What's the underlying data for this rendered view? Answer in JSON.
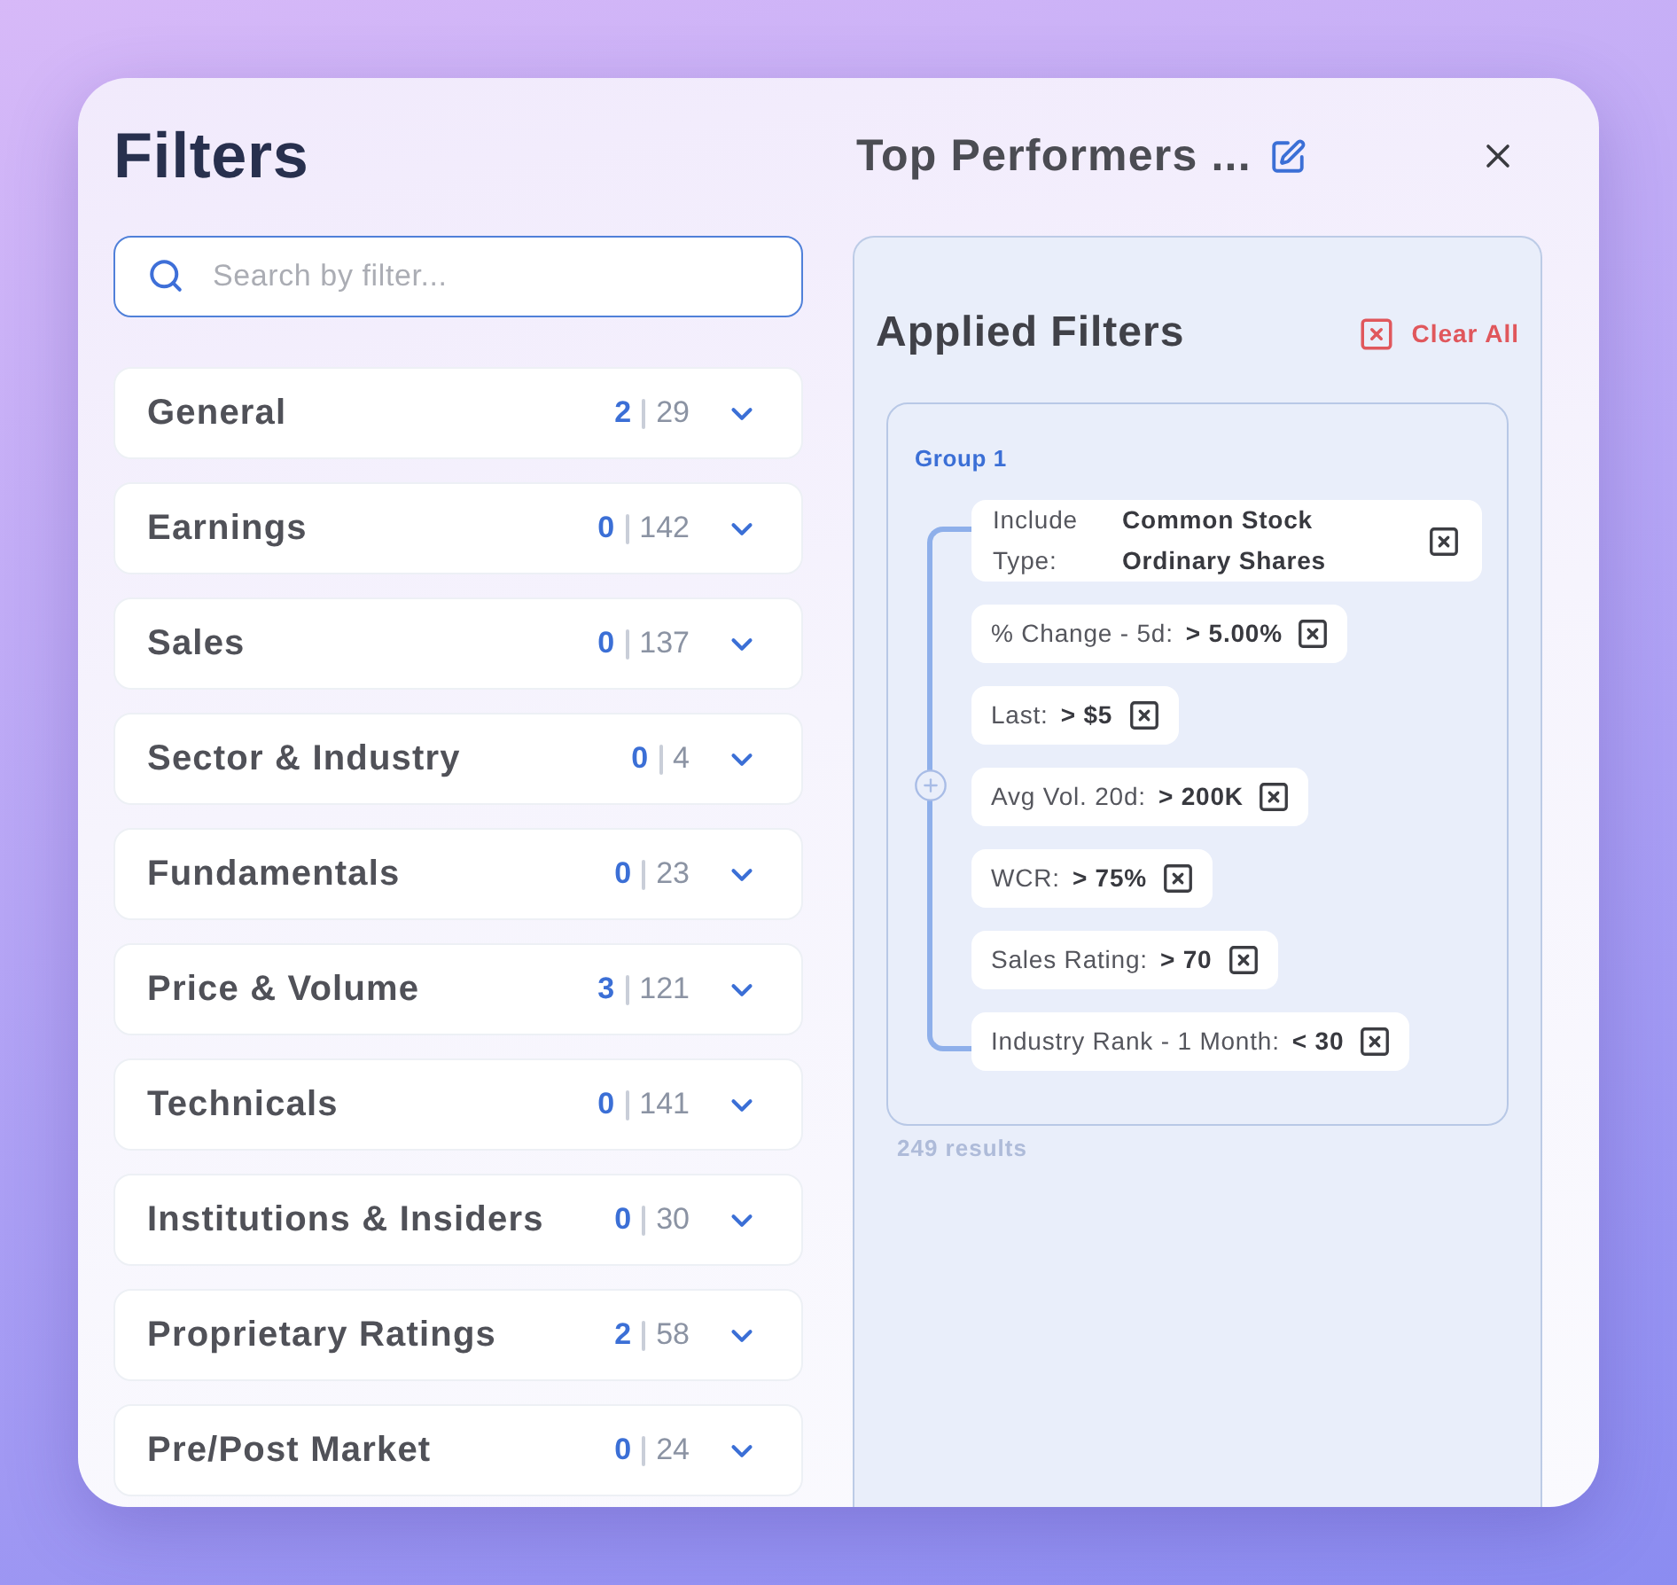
{
  "title": "Filters",
  "search": {
    "placeholder": "Search by filter..."
  },
  "categories": [
    {
      "label": "General",
      "selected_count": "2",
      "total_count": "29",
      "expanded": false
    },
    {
      "label": "Earnings",
      "selected_count": "0",
      "total_count": "142",
      "expanded": false
    },
    {
      "label": "Sales",
      "selected_count": "0",
      "total_count": "137",
      "expanded": false
    },
    {
      "label": "Sector & Industry",
      "selected_count": "0",
      "total_count": "4",
      "expanded": false
    },
    {
      "label": "Fundamentals",
      "selected_count": "0",
      "total_count": "23",
      "expanded": false
    },
    {
      "label": "Price & Volume",
      "selected_count": "3",
      "total_count": "121",
      "expanded": false
    },
    {
      "label": "Technicals",
      "selected_count": "0",
      "total_count": "141",
      "expanded": false
    },
    {
      "label": "Institutions & Insiders",
      "selected_count": "0",
      "total_count": "30",
      "expanded": false
    },
    {
      "label": "Proprietary Ratings",
      "selected_count": "2",
      "total_count": "58",
      "expanded": false
    },
    {
      "label": "Pre/Post Market",
      "selected_count": "0",
      "total_count": "24",
      "expanded": false
    }
  ],
  "preset": {
    "name": "Top Performers ..."
  },
  "applied_filters": {
    "title": "Applied Filters",
    "clear_all": "Clear All",
    "groups": [
      {
        "label": "Group 1",
        "filters": [
          {
            "kind": "multi",
            "label": "Include Type:",
            "values": [
              "Common Stock",
              "Ordinary Shares"
            ]
          },
          {
            "kind": "single",
            "label": "% Change - 5d:",
            "value": "> 5.00%"
          },
          {
            "kind": "single",
            "label": "Last:",
            "value": "> $5"
          },
          {
            "kind": "single",
            "label": "Avg Vol. 20d:",
            "value": "> 200K"
          },
          {
            "kind": "single",
            "label": "WCR:",
            "value": "> 75%"
          },
          {
            "kind": "single",
            "label": "Sales Rating:",
            "value": "> 70"
          },
          {
            "kind": "single",
            "label": "Industry Rank - 1 Month:",
            "value": "< 30"
          }
        ]
      }
    ],
    "results": "249 results"
  }
}
